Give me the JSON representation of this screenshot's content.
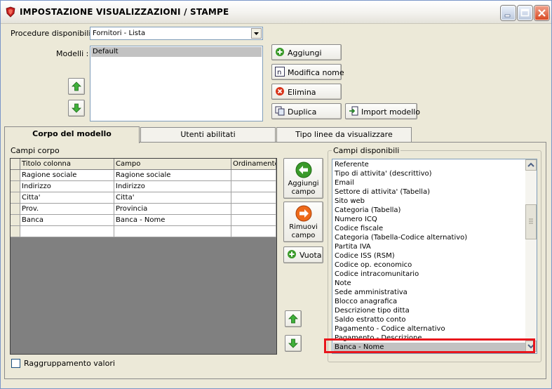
{
  "window": {
    "title": "IMPOSTAZIONE VISUALIZZAZIONI / STAMPE"
  },
  "procedure": {
    "label": "Procedure disponibili :",
    "selected": "Fornitori - Lista"
  },
  "models": {
    "label": "Modelli :",
    "items": [
      "Default"
    ]
  },
  "model_buttons": {
    "add": "Aggiungi",
    "rename": "Modifica nome",
    "delete": "Elimina",
    "duplicate": "Duplica",
    "import": "Import modello"
  },
  "tabs": [
    {
      "label": "Corpo del modello",
      "active": true
    },
    {
      "label": "Utenti abilitati",
      "active": false
    },
    {
      "label": "Tipo linee da visualizzare",
      "active": false
    }
  ],
  "campi_corpo": {
    "label": "Campi corpo",
    "columns": [
      "Titolo colonna",
      "Campo",
      "Ordinamento"
    ],
    "rows": [
      [
        "Ragione sociale",
        "Ragione sociale",
        ""
      ],
      [
        "Indirizzo",
        "Indirizzo",
        ""
      ],
      [
        "Citta'",
        "Citta'",
        ""
      ],
      [
        "Prov.",
        "Provincia",
        ""
      ],
      [
        "Banca",
        "Banca - Nome",
        ""
      ],
      [
        "",
        "",
        ""
      ]
    ]
  },
  "field_buttons": {
    "add_line1": "Aggiungi",
    "add_line2": "campo",
    "remove_line1": "Rimuovi",
    "remove_line2": "campo",
    "empty": "Vuota"
  },
  "campi_disponibili": {
    "label": "Campi disponibili",
    "items": [
      "Referente",
      "Tipo di attivita' (descrittivo)",
      "Email",
      "Settore di attivita' (Tabella)",
      "Sito web",
      "Categoria (Tabella)",
      "Numero ICQ",
      "Codice fiscale",
      "Categoria (Tabella-Codice alternativo)",
      "Partita IVA",
      "Codice ISS (RSM)",
      "Codice op. economico",
      "Codice intracomunitario",
      "Note",
      "Sede amministrativa",
      "Blocco anagrafica",
      "Descrizione tipo ditta",
      "Saldo estratto conto",
      "Pagamento - Codice alternativo",
      "Pagamento - Descrizione",
      "Banca - Nome"
    ],
    "selected_index": 20
  },
  "grouping": {
    "label": "Raggruppamento valori",
    "checked": false
  },
  "colors": {
    "highlight": "#e8161c",
    "selection": "#c2c2c2",
    "green_icon": "#3a9a2a",
    "red_icon": "#d8341a",
    "orange_icon": "#ee6a1a"
  },
  "icons": {
    "app": "shield-icon",
    "add": "plus-circle-icon",
    "rename": "n-letter-icon",
    "delete": "x-circle-icon",
    "duplicate": "copy-pages-icon",
    "import": "import-arrow-icon",
    "up": "arrow-up-icon",
    "down": "arrow-down-icon",
    "add_field": "arrow-left-circle-icon",
    "remove_field": "arrow-right-circle-icon"
  }
}
